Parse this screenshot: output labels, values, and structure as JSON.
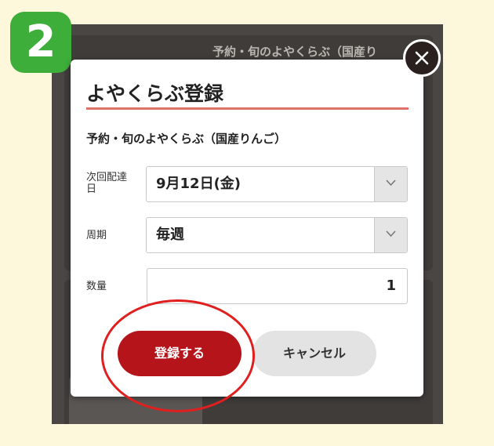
{
  "step": {
    "number": "2",
    "color": "#3eae3a"
  },
  "background": {
    "item_title": "予約・旬のよやくらぶ（国産り"
  },
  "modal": {
    "title": "よやくらぶ登録",
    "accent_color": "#e17269",
    "product_name": "予約・旬のよやくらぶ（国産りんご）",
    "fields": {
      "next_delivery": {
        "label": "次回配達日",
        "value": "9月12日(金)"
      },
      "cycle": {
        "label": "周期",
        "value": "毎週"
      },
      "quantity": {
        "label": "数量",
        "value": "1"
      }
    },
    "buttons": {
      "register": {
        "label": "登録する",
        "color": "#b5141a"
      },
      "cancel": {
        "label": "キャンセル"
      }
    },
    "close_icon": "close-icon"
  },
  "highlight": {
    "target": "register",
    "color": "#e01f1f"
  }
}
